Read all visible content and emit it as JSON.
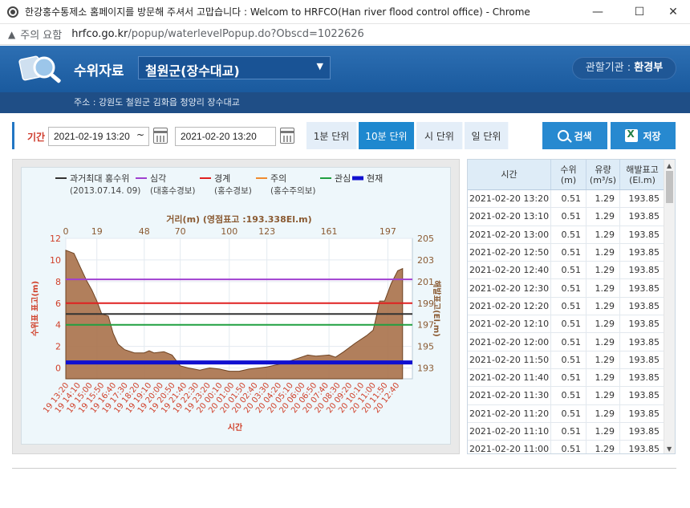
{
  "window": {
    "title": "한강홍수통제소 홈페이지를 방문해 주셔서 고맙습니다 : Welcom to HRFCO(Han river flood control office) - Chrome",
    "minimize": "—",
    "maximize": "☐",
    "close": "✕"
  },
  "address_bar": {
    "warning": "▲",
    "security_label": "주의 요함",
    "url_host": "hrfco.go.kr",
    "url_path": "/popup/waterlevelPopup.do?Obscd=1022626"
  },
  "header": {
    "label": "수위자료",
    "station": "철원군(장수대교)",
    "agency_prefix": "관할기관 : ",
    "agency": "환경부",
    "address": "주소 : 강원도 철원군 김화읍 청양리 장수대교"
  },
  "controls": {
    "period_label": "기간",
    "start": "2021-02-19 13:20",
    "tilde": "~",
    "end": "2021-02-20 13:20",
    "units": [
      "1분 단위",
      "10분 단위",
      "시 단위",
      "일 단위"
    ],
    "active_unit": 1,
    "search": "검색",
    "save": "저장"
  },
  "chart_data": {
    "type": "area",
    "legend": [
      {
        "name": "과거최대 홍수위",
        "sub": "(2013.07.14. 09)",
        "color": "#333333"
      },
      {
        "name": "심각",
        "sub": "(대홍수경보)",
        "color": "#a040d0"
      },
      {
        "name": "경계",
        "sub": "(홍수경보)",
        "color": "#e02020"
      },
      {
        "name": "주의",
        "sub": "(홍수주의보)",
        "color": "#f08a30"
      },
      {
        "name": "관심",
        "sub": "",
        "color": "#20a040"
      },
      {
        "name": "현재",
        "sub": "",
        "color": "#1010d0"
      }
    ],
    "top_axis_title": "거리(m) (영점표고 :193.338El.m)",
    "top_ticks": [
      0,
      19,
      48,
      70,
      100,
      123,
      161,
      197
    ],
    "left_axis_title": "수위표 표고(m)",
    "right_axis_title": "해발표고(El.m)",
    "x_axis_title": "시간",
    "left_ticks": [
      0,
      2,
      4,
      6,
      8,
      10,
      12
    ],
    "right_ticks": [
      193,
      195,
      197,
      199,
      201,
      203,
      205
    ],
    "ylim": [
      -1,
      12
    ],
    "xlim": [
      0,
      212
    ],
    "reference_lines": [
      {
        "name": "심각",
        "value": 8.2
      },
      {
        "name": "경계",
        "value": 6.0
      },
      {
        "name": "과거최대 홍수위",
        "value": 5.0
      },
      {
        "name": "관심",
        "value": 4.0
      },
      {
        "name": "현재",
        "value": 0.51
      }
    ],
    "profile": [
      [
        0,
        10.9
      ],
      [
        5,
        10.6
      ],
      [
        9,
        9.3
      ],
      [
        13,
        8.0
      ],
      [
        16,
        7.2
      ],
      [
        19,
        6.2
      ],
      [
        22,
        5.0
      ],
      [
        26,
        4.8
      ],
      [
        29,
        3.2
      ],
      [
        32,
        2.2
      ],
      [
        36,
        1.7
      ],
      [
        42,
        1.4
      ],
      [
        48,
        1.4
      ],
      [
        51,
        1.6
      ],
      [
        54,
        1.4
      ],
      [
        60,
        1.5
      ],
      [
        65,
        1.2
      ],
      [
        70,
        0.2
      ],
      [
        75,
        0.0
      ],
      [
        82,
        -0.2
      ],
      [
        88,
        0.0
      ],
      [
        94,
        -0.1
      ],
      [
        100,
        -0.3
      ],
      [
        106,
        -0.3
      ],
      [
        112,
        -0.1
      ],
      [
        118,
        0.0
      ],
      [
        123,
        0.1
      ],
      [
        132,
        0.4
      ],
      [
        140,
        0.8
      ],
      [
        148,
        1.2
      ],
      [
        153,
        1.1
      ],
      [
        161,
        1.2
      ],
      [
        165,
        1.0
      ],
      [
        170,
        1.5
      ],
      [
        177,
        2.3
      ],
      [
        184,
        3.0
      ],
      [
        188,
        3.5
      ],
      [
        190,
        4.8
      ],
      [
        192,
        6.2
      ],
      [
        195,
        6.2
      ],
      [
        199,
        7.8
      ],
      [
        203,
        9.0
      ],
      [
        206,
        9.2
      ]
    ],
    "time_ticks": [
      "19 13:20",
      "19 14:10",
      "19 15:00",
      "19 15:50",
      "19 16:40",
      "19 17:30",
      "19 18:20",
      "19 19:10",
      "19 20:00",
      "19 20:50",
      "19 21:40",
      "19 22:30",
      "19 23:20",
      "20 00:10",
      "20 01:00",
      "20 01:50",
      "20 02:40",
      "20 03:30",
      "20 04:20",
      "20 05:10",
      "20 06:00",
      "20 06:50",
      "20 07:40",
      "20 08:30",
      "20 09:20",
      "20 10:10",
      "20 11:00",
      "20 11:50",
      "20 12:40"
    ]
  },
  "table": {
    "headers": [
      {
        "l1": "시간",
        "l2": ""
      },
      {
        "l1": "수위",
        "l2": "(m)"
      },
      {
        "l1": "유량",
        "l2": "(m³/s)"
      },
      {
        "l1": "해발표고",
        "l2": "(El.m)"
      }
    ],
    "rows": [
      [
        "2021-02-20 13:20",
        "0.51",
        "1.29",
        "193.85"
      ],
      [
        "2021-02-20 13:10",
        "0.51",
        "1.29",
        "193.85"
      ],
      [
        "2021-02-20 13:00",
        "0.51",
        "1.29",
        "193.85"
      ],
      [
        "2021-02-20 12:50",
        "0.51",
        "1.29",
        "193.85"
      ],
      [
        "2021-02-20 12:40",
        "0.51",
        "1.29",
        "193.85"
      ],
      [
        "2021-02-20 12:30",
        "0.51",
        "1.29",
        "193.85"
      ],
      [
        "2021-02-20 12:20",
        "0.51",
        "1.29",
        "193.85"
      ],
      [
        "2021-02-20 12:10",
        "0.51",
        "1.29",
        "193.85"
      ],
      [
        "2021-02-20 12:00",
        "0.51",
        "1.29",
        "193.85"
      ],
      [
        "2021-02-20 11:50",
        "0.51",
        "1.29",
        "193.85"
      ],
      [
        "2021-02-20 11:40",
        "0.51",
        "1.29",
        "193.85"
      ],
      [
        "2021-02-20 11:30",
        "0.51",
        "1.29",
        "193.85"
      ],
      [
        "2021-02-20 11:20",
        "0.51",
        "1.29",
        "193.85"
      ],
      [
        "2021-02-20 11:10",
        "0.51",
        "1.29",
        "193.85"
      ],
      [
        "2021-02-20 11:00",
        "0.51",
        "1.29",
        "193.85"
      ]
    ]
  }
}
